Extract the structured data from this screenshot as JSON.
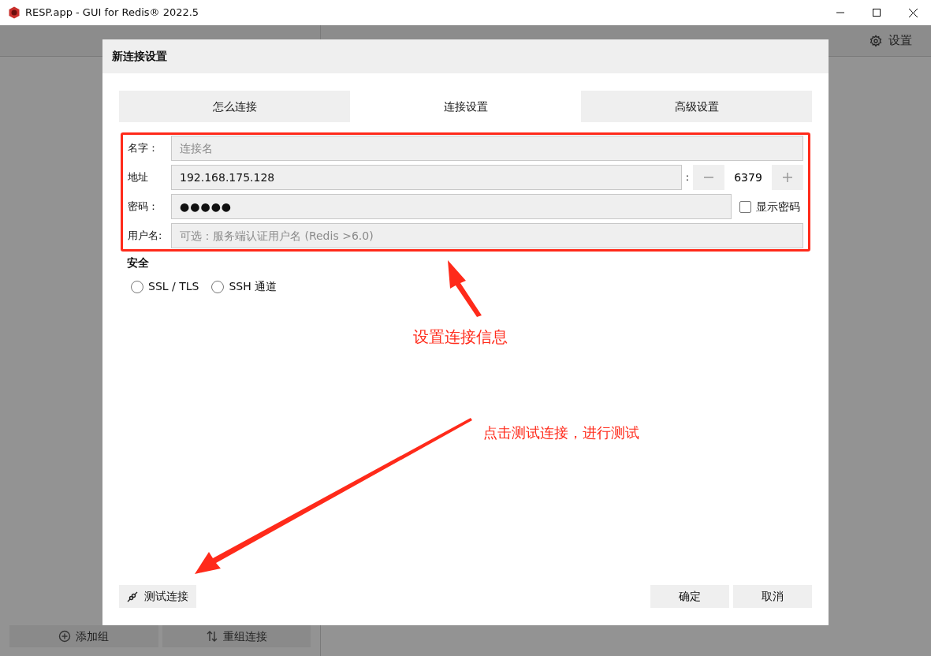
{
  "window": {
    "title": "RESP.app - GUI for Redis® 2022.5"
  },
  "toolbar": {
    "settings": "设置"
  },
  "sidebar_buttons": [
    {
      "kind": "add",
      "label": "添加组"
    },
    {
      "kind": "reorder",
      "label": "重组连接"
    }
  ],
  "dialog": {
    "title": "新连接设置",
    "tabs": [
      {
        "label": "怎么连接",
        "selected": false
      },
      {
        "label": "连接设置",
        "selected": true
      },
      {
        "label": "高级设置",
        "selected": false
      }
    ],
    "fields": [
      {
        "kind": "text",
        "label": "名字：",
        "placeholder": "连接名"
      },
      {
        "kind": "address",
        "label": "地址",
        "value": "192.168.175.128",
        "separator": ":",
        "port": "6379"
      },
      {
        "kind": "password",
        "label": "密码：",
        "value": "●●●●●",
        "toggle": {
          "label": "显示密码",
          "checked": false
        }
      },
      {
        "kind": "text",
        "label": "用户名:",
        "placeholder": "可选：服务端认证用户名 (Redis >6.0)"
      }
    ],
    "security": {
      "title": "安全",
      "options": [
        {
          "label": "SSL / TLS",
          "selected": false
        },
        {
          "label": "SSH 通道",
          "selected": false
        }
      ]
    },
    "test_button": "测试连接",
    "ok_button": "确定",
    "cancel_button": "取消"
  },
  "annotations": [
    {
      "text": "设置连接信息"
    },
    {
      "text": "点击测试连接，进行测试"
    }
  ]
}
